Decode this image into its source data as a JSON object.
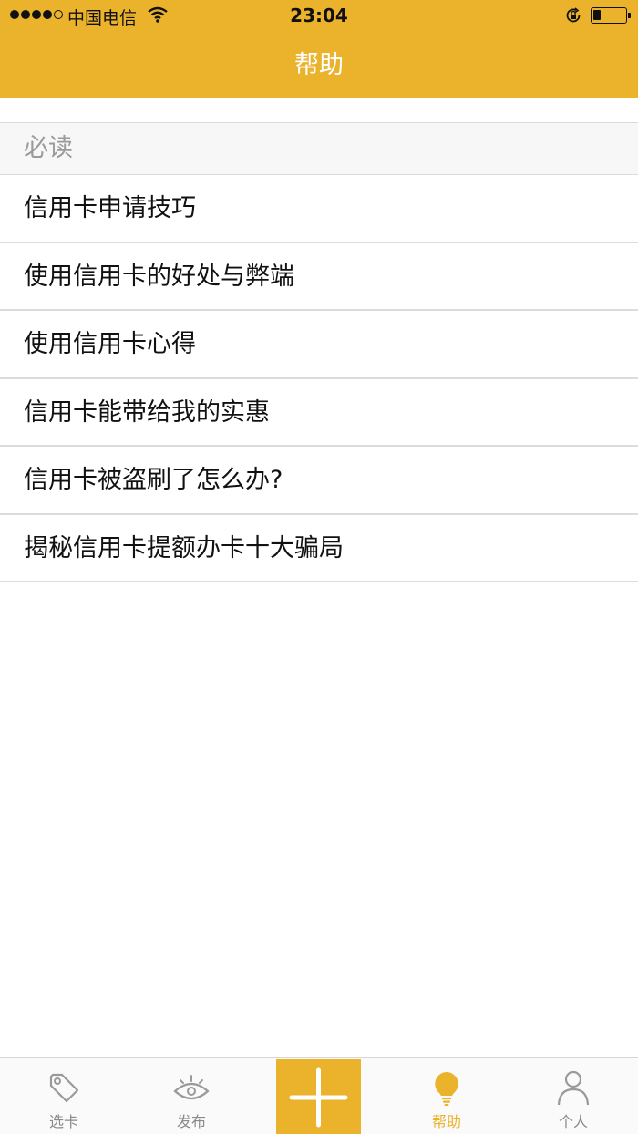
{
  "status_bar": {
    "carrier": "中国电信",
    "time": "23:04"
  },
  "nav": {
    "title": "帮助"
  },
  "section": {
    "title": "必读",
    "items": [
      {
        "label": "信用卡申请技巧"
      },
      {
        "label": "使用信用卡的好处与弊端"
      },
      {
        "label": "使用信用卡心得"
      },
      {
        "label": "信用卡能带给我的实惠"
      },
      {
        "label": "信用卡被盗刷了怎么办?"
      },
      {
        "label": "揭秘信用卡提额办卡十大骗局"
      }
    ]
  },
  "tabbar": {
    "tabs": [
      {
        "label": "选卡",
        "icon": "tag-icon"
      },
      {
        "label": "发布",
        "icon": "eye-icon"
      },
      {
        "label": "",
        "icon": "plus-icon"
      },
      {
        "label": "帮助",
        "icon": "lightbulb-icon",
        "active": true
      },
      {
        "label": "个人",
        "icon": "person-icon"
      }
    ],
    "active_color": "#EBB22C"
  },
  "colors": {
    "header": "#EBB22C",
    "section_bg": "#F7F7F7"
  }
}
